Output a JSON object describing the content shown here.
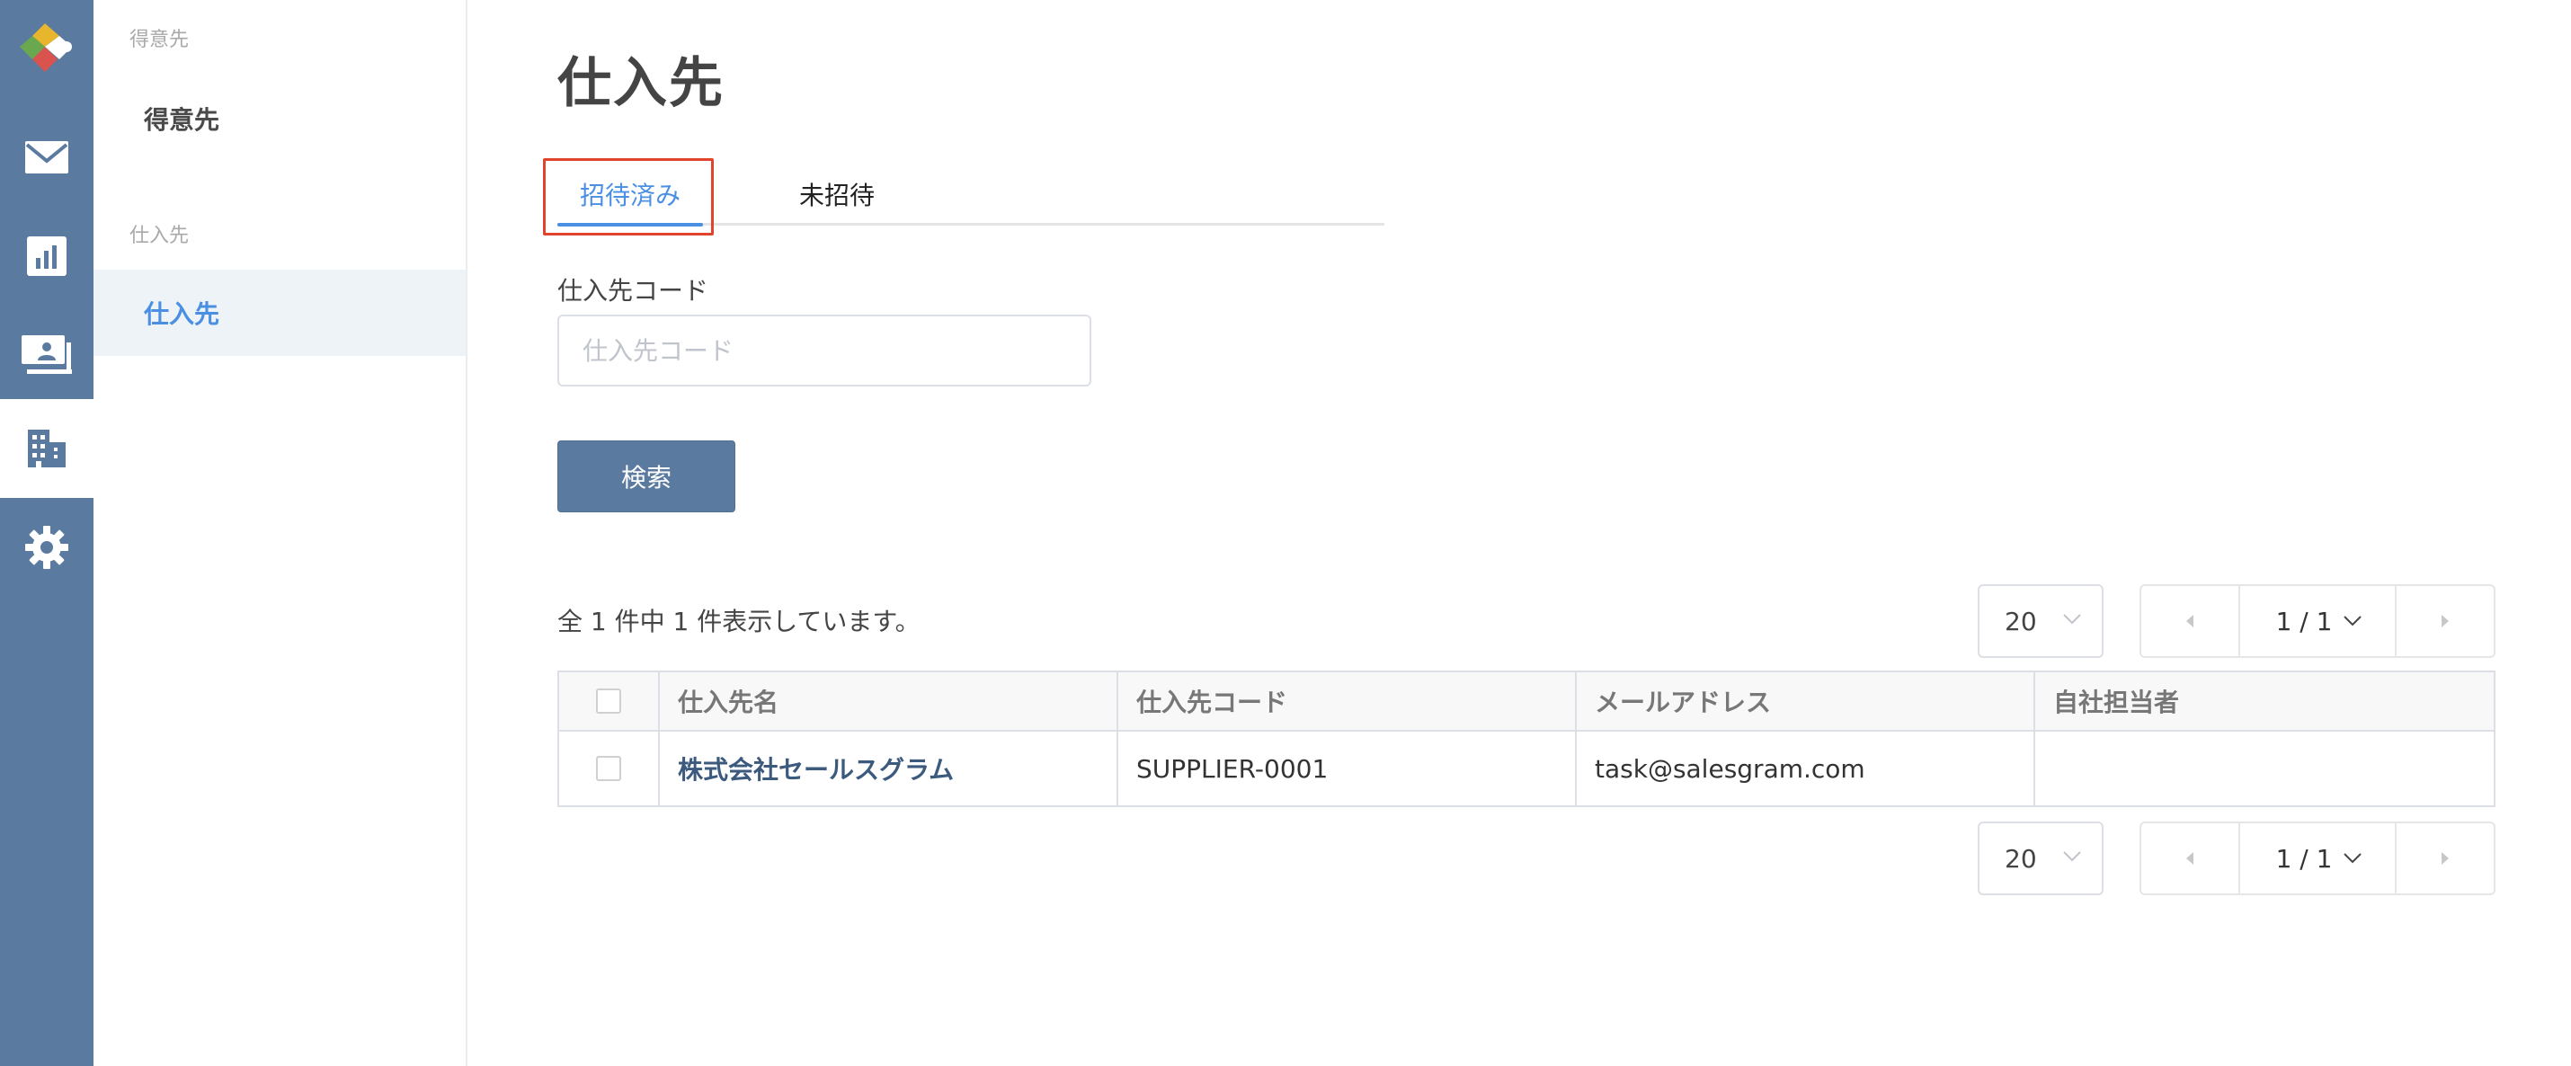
{
  "rail": {
    "items": [
      {
        "icon": "mail-icon"
      },
      {
        "icon": "chart-icon"
      },
      {
        "icon": "presentation-icon"
      },
      {
        "icon": "building-icon",
        "active": true
      },
      {
        "icon": "gear-icon"
      }
    ]
  },
  "sidebar": {
    "group1": "得意先",
    "item1": "得意先",
    "group2": "仕入先",
    "item2": "仕入先"
  },
  "main": {
    "title": "仕入先",
    "tabs": [
      {
        "label": "招待済み",
        "active": true
      },
      {
        "label": "未招待"
      }
    ],
    "search": {
      "label": "仕入先コード",
      "placeholder": "仕入先コード",
      "value": "",
      "button": "検索"
    },
    "result_count": "全 1 件中 1 件表示しています。",
    "pager": {
      "page_size": "20",
      "page": "1 / 1"
    },
    "table": {
      "columns": [
        "仕入先名",
        "仕入先コード",
        "メールアドレス",
        "自社担当者"
      ],
      "rows": [
        {
          "name": "株式会社セールスグラム",
          "code": "SUPPLIER-0001",
          "email": "task@salesgram.com",
          "owner": ""
        }
      ]
    }
  },
  "colors": {
    "rail": "#5b7aa0",
    "accent": "#4a8fe2",
    "highlight": "#e0442c",
    "link": "#3b5a7e"
  }
}
